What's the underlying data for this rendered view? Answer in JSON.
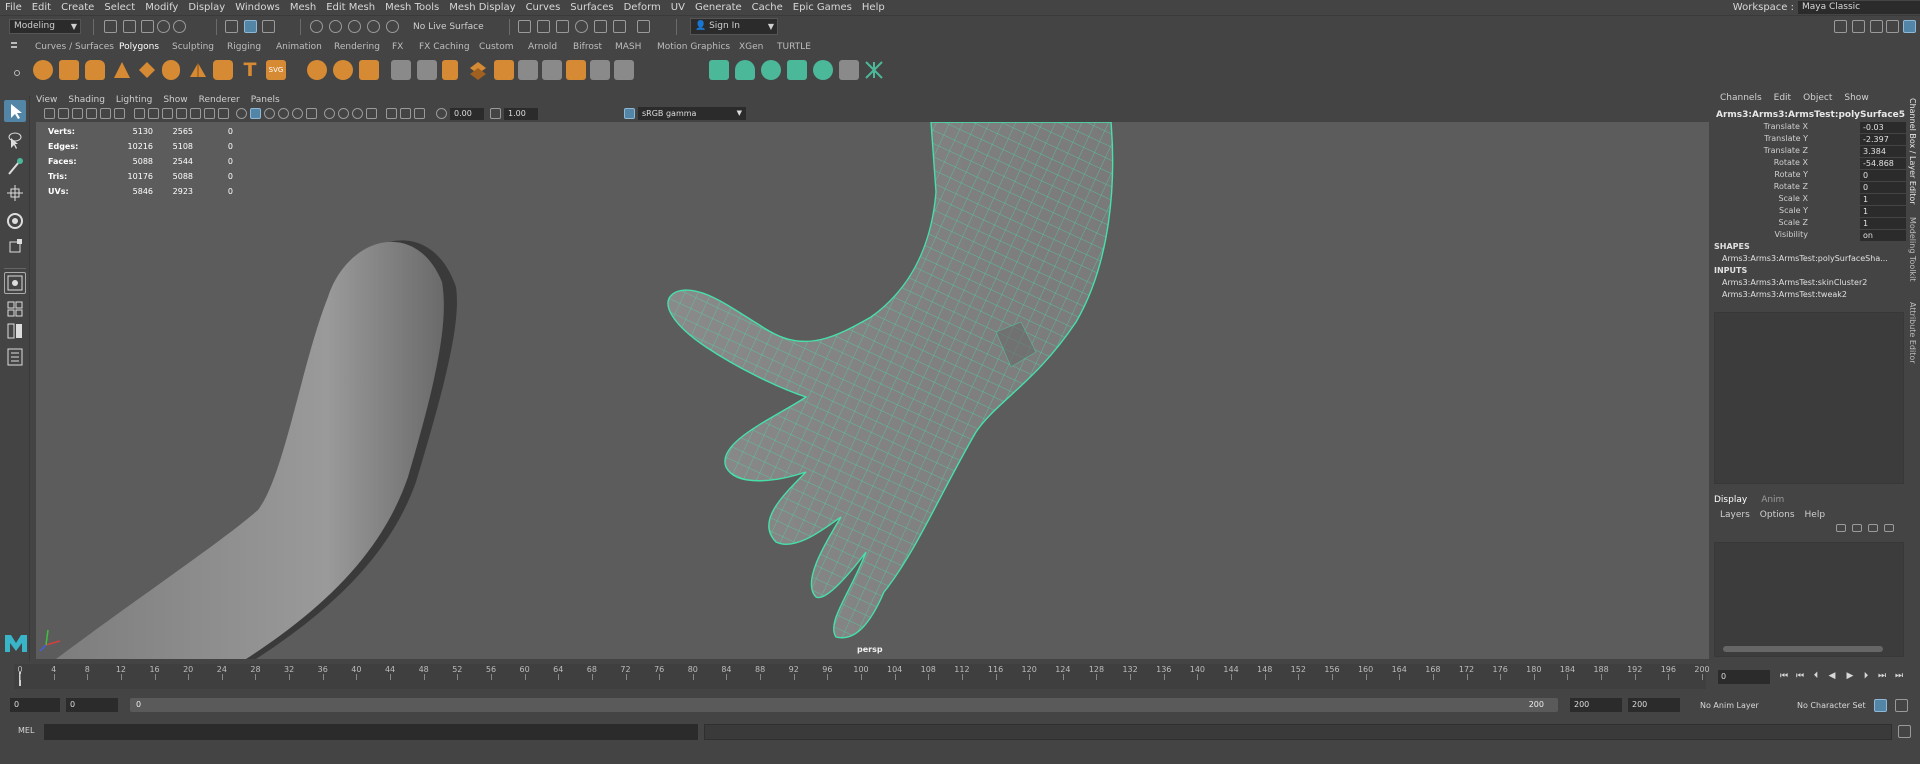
{
  "menubar": {
    "items": [
      "File",
      "Edit",
      "Create",
      "Select",
      "Modify",
      "Display",
      "Windows",
      "Mesh",
      "Edit Mesh",
      "Mesh Tools",
      "Mesh Display",
      "Curves",
      "Surfaces",
      "Deform",
      "UV",
      "Generate",
      "Cache",
      "Epic Games",
      "Help"
    ],
    "workspace_label": "Workspace :",
    "workspace_value": "Maya Classic"
  },
  "statusline": {
    "mode": "Modeling",
    "live_surface": "No Live Surface",
    "sign_in": "Sign In"
  },
  "shelf": {
    "tabs": [
      "Curves / Surfaces",
      "Polygons",
      "Sculpting",
      "Rigging",
      "Animation",
      "Rendering",
      "FX",
      "FX Caching",
      "Custom",
      "Arnold",
      "Bifrost",
      "MASH",
      "Motion Graphics",
      "XGen",
      "TURTLE"
    ],
    "active_tab": "Polygons"
  },
  "panel": {
    "menus": [
      "View",
      "Shading",
      "Lighting",
      "Show",
      "Renderer",
      "Panels"
    ],
    "exposure": "0.00",
    "gamma": "1.00",
    "color_space": "sRGB gamma",
    "camera": "persp"
  },
  "hud": {
    "rows": [
      {
        "label": "Verts:",
        "a": "5130",
        "b": "2565",
        "c": "0"
      },
      {
        "label": "Edges:",
        "a": "10216",
        "b": "5108",
        "c": "0"
      },
      {
        "label": "Faces:",
        "a": "5088",
        "b": "2544",
        "c": "0"
      },
      {
        "label": "Tris:",
        "a": "10176",
        "b": "5088",
        "c": "0"
      },
      {
        "label": "UVs:",
        "a": "5846",
        "b": "2923",
        "c": "0"
      }
    ]
  },
  "channelbox": {
    "menus": [
      "Channels",
      "Edit",
      "Object",
      "Show"
    ],
    "node": "Arms3:Arms3:ArmsTest:polySurface5",
    "attrs": [
      {
        "name": "Translate X",
        "value": "-0.03"
      },
      {
        "name": "Translate Y",
        "value": "-2.397"
      },
      {
        "name": "Translate Z",
        "value": "3.384"
      },
      {
        "name": "Rotate X",
        "value": "-54.868"
      },
      {
        "name": "Rotate Y",
        "value": "0"
      },
      {
        "name": "Rotate Z",
        "value": "0"
      },
      {
        "name": "Scale X",
        "value": "1"
      },
      {
        "name": "Scale Y",
        "value": "1"
      },
      {
        "name": "Scale Z",
        "value": "1"
      },
      {
        "name": "Visibility",
        "value": "on"
      }
    ],
    "shapes_label": "SHAPES",
    "shapes": [
      "Arms3:Arms3:ArmsTest:polySurfaceSha..."
    ],
    "inputs_label": "INPUTS",
    "inputs": [
      "Arms3:Arms3:ArmsTest:skinCluster2",
      "Arms3:Arms3:ArmsTest:tweak2"
    ]
  },
  "layer_editor": {
    "tabs": [
      "Display",
      "Anim"
    ],
    "menus": [
      "Layers",
      "Options",
      "Help"
    ]
  },
  "side_tabs": [
    "Channel Box / Layer Editor",
    "Modeling Toolkit",
    "Attribute Editor"
  ],
  "timeslider": {
    "ticks": [
      "0",
      "4",
      "8",
      "12",
      "16",
      "20",
      "24",
      "28",
      "32",
      "36",
      "40",
      "44",
      "48",
      "52",
      "56",
      "60",
      "64",
      "68",
      "72",
      "76",
      "80",
      "84",
      "88",
      "92",
      "96",
      "100",
      "104",
      "108",
      "112",
      "116",
      "120",
      "124",
      "128",
      "132",
      "136",
      "140",
      "144",
      "148",
      "152",
      "156",
      "160",
      "164",
      "168",
      "172",
      "176",
      "180",
      "184",
      "188",
      "192",
      "196",
      "200"
    ],
    "current_frame": "0"
  },
  "range": {
    "start": "0",
    "anim_start": "0",
    "range_lo": "0",
    "range_hi": "200",
    "anim_end": "200",
    "end": "200",
    "anim_layer": "No Anim Layer",
    "character_set": "No Character Set"
  },
  "cmd": {
    "lang": "MEL"
  },
  "colors": {
    "accent": "#5285a6",
    "wire": "#46e0a8",
    "icon_orange": "#d68a33",
    "icon_teal": "#4bb89a"
  }
}
